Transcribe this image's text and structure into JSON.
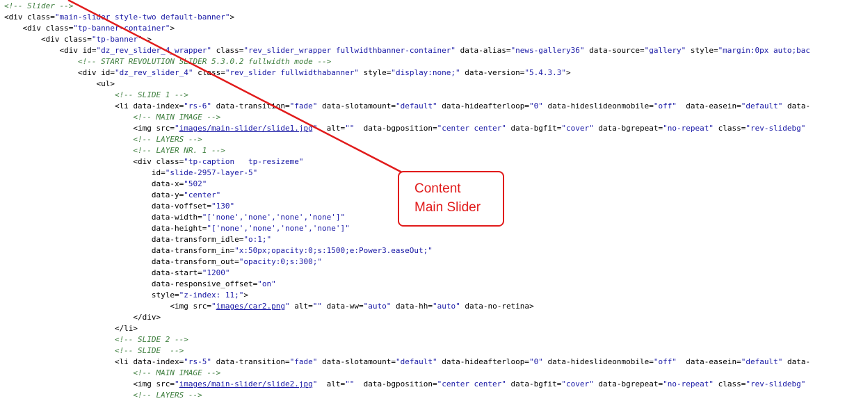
{
  "code_lines": [
    [
      [
        "c",
        "<!-- Slider -->"
      ]
    ],
    [
      [
        "t",
        "<div "
      ],
      [
        "a",
        "class="
      ],
      [
        "v",
        "\"main-slider style-two default-banner\""
      ],
      [
        "t",
        ">"
      ]
    ],
    [
      [
        "t",
        "    <div "
      ],
      [
        "a",
        "class="
      ],
      [
        "v",
        "\"tp-banner-container\""
      ],
      [
        "t",
        ">"
      ]
    ],
    [
      [
        "t",
        "        <div "
      ],
      [
        "a",
        "class="
      ],
      [
        "v",
        "\"tp-banner\""
      ],
      [
        "t",
        " >"
      ]
    ],
    [
      [
        "t",
        "            <div "
      ],
      [
        "a",
        "id="
      ],
      [
        "v",
        "\"dz_rev_slider_4_wrapper\""
      ],
      [
        "a",
        " class="
      ],
      [
        "v",
        "\"rev_slider_wrapper fullwidthbanner-container\""
      ],
      [
        "a",
        " data-alias="
      ],
      [
        "v",
        "\"news-gallery36\""
      ],
      [
        "a",
        " data-source="
      ],
      [
        "v",
        "\"gallery\""
      ],
      [
        "a",
        " style="
      ],
      [
        "v",
        "\"margin:0px auto;bac"
      ]
    ],
    [
      [
        "c",
        "                <!-- START REVOLUTION SLIDER 5.3.0.2 fullwidth mode -->"
      ]
    ],
    [
      [
        "t",
        "                <div "
      ],
      [
        "a",
        "id="
      ],
      [
        "v",
        "\"dz_rev_slider_4\""
      ],
      [
        "a",
        " class="
      ],
      [
        "v",
        "\"rev_slider fullwidthabanner\""
      ],
      [
        "a",
        " style="
      ],
      [
        "v",
        "\"display:none;\""
      ],
      [
        "a",
        " data-version="
      ],
      [
        "v",
        "\"5.4.3.3\""
      ],
      [
        "t",
        ">"
      ]
    ],
    [
      [
        "t",
        "                    <ul>"
      ]
    ],
    [
      [
        "c",
        "                        <!-- SLIDE 1 -->"
      ]
    ],
    [
      [
        "t",
        "                        <li "
      ],
      [
        "a",
        "data-index="
      ],
      [
        "v",
        "\"rs-6\""
      ],
      [
        "a",
        " data-transition="
      ],
      [
        "v",
        "\"fade\""
      ],
      [
        "a",
        " data-slotamount="
      ],
      [
        "v",
        "\"default\""
      ],
      [
        "a",
        " data-hideafterloop="
      ],
      [
        "v",
        "\"0\""
      ],
      [
        "a",
        " data-hideslideonmobile="
      ],
      [
        "v",
        "\"off\""
      ],
      [
        "a",
        "  data-easein="
      ],
      [
        "v",
        "\"default\""
      ],
      [
        "a",
        " data-"
      ]
    ],
    [
      [
        "c",
        "                            <!-- MAIN IMAGE -->"
      ]
    ],
    [
      [
        "t",
        "                            <img "
      ],
      [
        "a",
        "src="
      ],
      [
        "v",
        "\""
      ],
      [
        "lnk",
        "images/main-slider/slide1.jpg"
      ],
      [
        "v",
        "\""
      ],
      [
        "a",
        "  alt="
      ],
      [
        "v",
        "\"\""
      ],
      [
        "a",
        "  data-bgposition="
      ],
      [
        "v",
        "\"center center\""
      ],
      [
        "a",
        " data-bgfit="
      ],
      [
        "v",
        "\"cover\""
      ],
      [
        "a",
        " data-bgrepeat="
      ],
      [
        "v",
        "\"no-repeat\""
      ],
      [
        "a",
        " class="
      ],
      [
        "v",
        "\"rev-slidebg\""
      ]
    ],
    [
      [
        "c",
        "                            <!-- LAYERS -->"
      ]
    ],
    [
      [
        "c",
        "                            <!-- LAYER NR. 1 -->"
      ]
    ],
    [
      [
        "t",
        "                            <div "
      ],
      [
        "a",
        "class="
      ],
      [
        "v",
        "\"tp-caption   tp-resizeme\""
      ]
    ],
    [
      [
        "a",
        "                                id="
      ],
      [
        "v",
        "\"slide-2957-layer-5\""
      ]
    ],
    [
      [
        "a",
        "                                data-x="
      ],
      [
        "v",
        "\"502\""
      ]
    ],
    [
      [
        "a",
        "                                data-y="
      ],
      [
        "v",
        "\"center\""
      ]
    ],
    [
      [
        "a",
        "                                data-voffset="
      ],
      [
        "v",
        "\"130\""
      ]
    ],
    [
      [
        "a",
        "                                data-width="
      ],
      [
        "v",
        "\"['none','none','none','none']\""
      ]
    ],
    [
      [
        "a",
        "                                data-height="
      ],
      [
        "v",
        "\"['none','none','none','none']\""
      ]
    ],
    [
      [
        "a",
        "                                data-transform_idle="
      ],
      [
        "v",
        "\"o:1;\""
      ]
    ],
    [
      [
        "a",
        "                                data-transform_in="
      ],
      [
        "v",
        "\"x:50px;opacity:0;s:1500;e:Power3.easeOut;\""
      ]
    ],
    [
      [
        "a",
        "                                data-transform_out="
      ],
      [
        "v",
        "\"opacity:0;s:300;\""
      ]
    ],
    [
      [
        "a",
        "                                data-start="
      ],
      [
        "v",
        "\"1200\""
      ]
    ],
    [
      [
        "a",
        "                                data-responsive_offset="
      ],
      [
        "v",
        "\"on\""
      ]
    ],
    [
      [
        "a",
        "                                style="
      ],
      [
        "v",
        "\"z-index: 11;\""
      ],
      [
        "t",
        ">"
      ]
    ],
    [
      [
        "t",
        "                                    <img "
      ],
      [
        "a",
        "src="
      ],
      [
        "v",
        "\""
      ],
      [
        "lnk",
        "images/car2.png"
      ],
      [
        "v",
        "\""
      ],
      [
        "a",
        " alt="
      ],
      [
        "v",
        "\"\""
      ],
      [
        "a",
        " data-ww="
      ],
      [
        "v",
        "\"auto\""
      ],
      [
        "a",
        " data-hh="
      ],
      [
        "v",
        "\"auto\""
      ],
      [
        "a",
        " data-no-retina"
      ],
      [
        "t",
        ">"
      ]
    ],
    [
      [
        "t",
        "                            </div>"
      ]
    ],
    [
      [
        "t",
        "                        </li>"
      ]
    ],
    [
      [
        "c",
        "                        <!-- SLIDE 2 -->"
      ]
    ],
    [
      [
        "c",
        "                        <!-- SLIDE  -->"
      ]
    ],
    [
      [
        "t",
        "                        <li "
      ],
      [
        "a",
        "data-index="
      ],
      [
        "v",
        "\"rs-5\""
      ],
      [
        "a",
        " data-transition="
      ],
      [
        "v",
        "\"fade\""
      ],
      [
        "a",
        " data-slotamount="
      ],
      [
        "v",
        "\"default\""
      ],
      [
        "a",
        " data-hideafterloop="
      ],
      [
        "v",
        "\"0\""
      ],
      [
        "a",
        " data-hideslideonmobile="
      ],
      [
        "v",
        "\"off\""
      ],
      [
        "a",
        "  data-easein="
      ],
      [
        "v",
        "\"default\""
      ],
      [
        "a",
        " data-"
      ]
    ],
    [
      [
        "c",
        "                            <!-- MAIN IMAGE -->"
      ]
    ],
    [
      [
        "t",
        "                            <img "
      ],
      [
        "a",
        "src="
      ],
      [
        "v",
        "\""
      ],
      [
        "lnk",
        "images/main-slider/slide2.jpg"
      ],
      [
        "v",
        "\""
      ],
      [
        "a",
        "  alt="
      ],
      [
        "v",
        "\"\""
      ],
      [
        "a",
        "  data-bgposition="
      ],
      [
        "v",
        "\"center center\""
      ],
      [
        "a",
        " data-bgfit="
      ],
      [
        "v",
        "\"cover\""
      ],
      [
        "a",
        " data-bgrepeat="
      ],
      [
        "v",
        "\"no-repeat\""
      ],
      [
        "a",
        " class="
      ],
      [
        "v",
        "\"rev-slidebg\""
      ]
    ],
    [
      [
        "c",
        "                            <!-- LAYERS -->"
      ]
    ]
  ],
  "callout": {
    "line1": "Content",
    "line2": "Main Slider"
  },
  "colors": {
    "annotation": "#e11b1b",
    "comment": "#3f7f3f",
    "attribute_value": "#1a1aa6"
  }
}
